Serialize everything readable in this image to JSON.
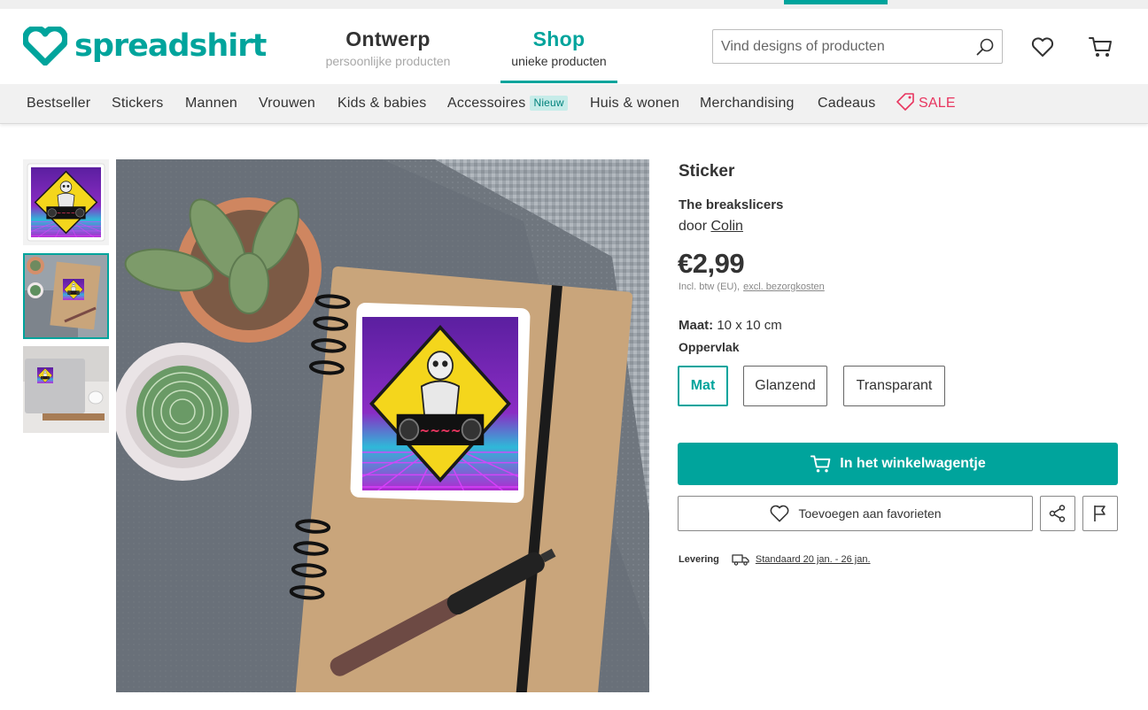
{
  "brand": {
    "name": "spreadshirt",
    "color": "#00a49c"
  },
  "header": {
    "tabs": [
      {
        "label": "Ontwerp",
        "sublabel": "persoonlijke producten"
      },
      {
        "label": "Shop",
        "sublabel": "unieke producten",
        "active": true
      }
    ],
    "search": {
      "placeholder": "Vind designs of producten",
      "value": ""
    },
    "icons": [
      "search-icon",
      "heart-icon",
      "cart-icon"
    ]
  },
  "categories": {
    "items": [
      "Bestseller",
      "Stickers",
      "Mannen",
      "Vrouwen",
      "Kids & babies",
      "Accessoires",
      "Huis & wonen",
      "Merchandising",
      "Cadeaus"
    ],
    "new_badge": "Nieuw",
    "sale": "SALE"
  },
  "gallery": {
    "thumbnails": [
      "sticker-design",
      "sticker-on-notebook",
      "sticker-on-laptop"
    ],
    "active_index": 1
  },
  "product": {
    "type": "Sticker",
    "name": "The breakslicers",
    "by_prefix": "door",
    "author": "Colin",
    "price": "€2,99",
    "tax_note": "Incl. btw (EU),",
    "shipping_link": "excl. bezorgkosten",
    "size_label": "Maat:",
    "size_value": "10 x 10 cm",
    "surface_label": "Oppervlak",
    "surface_options": [
      "Mat",
      "Glanzend",
      "Transparant"
    ],
    "selected_surface": "Mat",
    "cart_button": "In het winkelwagentje",
    "favorite_button": "Toevoegen aan favorieten",
    "delivery_label": "Levering",
    "delivery_value": "Standaard 20 jan. - 26 jan."
  },
  "colors": {
    "accent": "#00a49c",
    "sale": "#e8355f",
    "badge_bg": "#c6ece9"
  }
}
